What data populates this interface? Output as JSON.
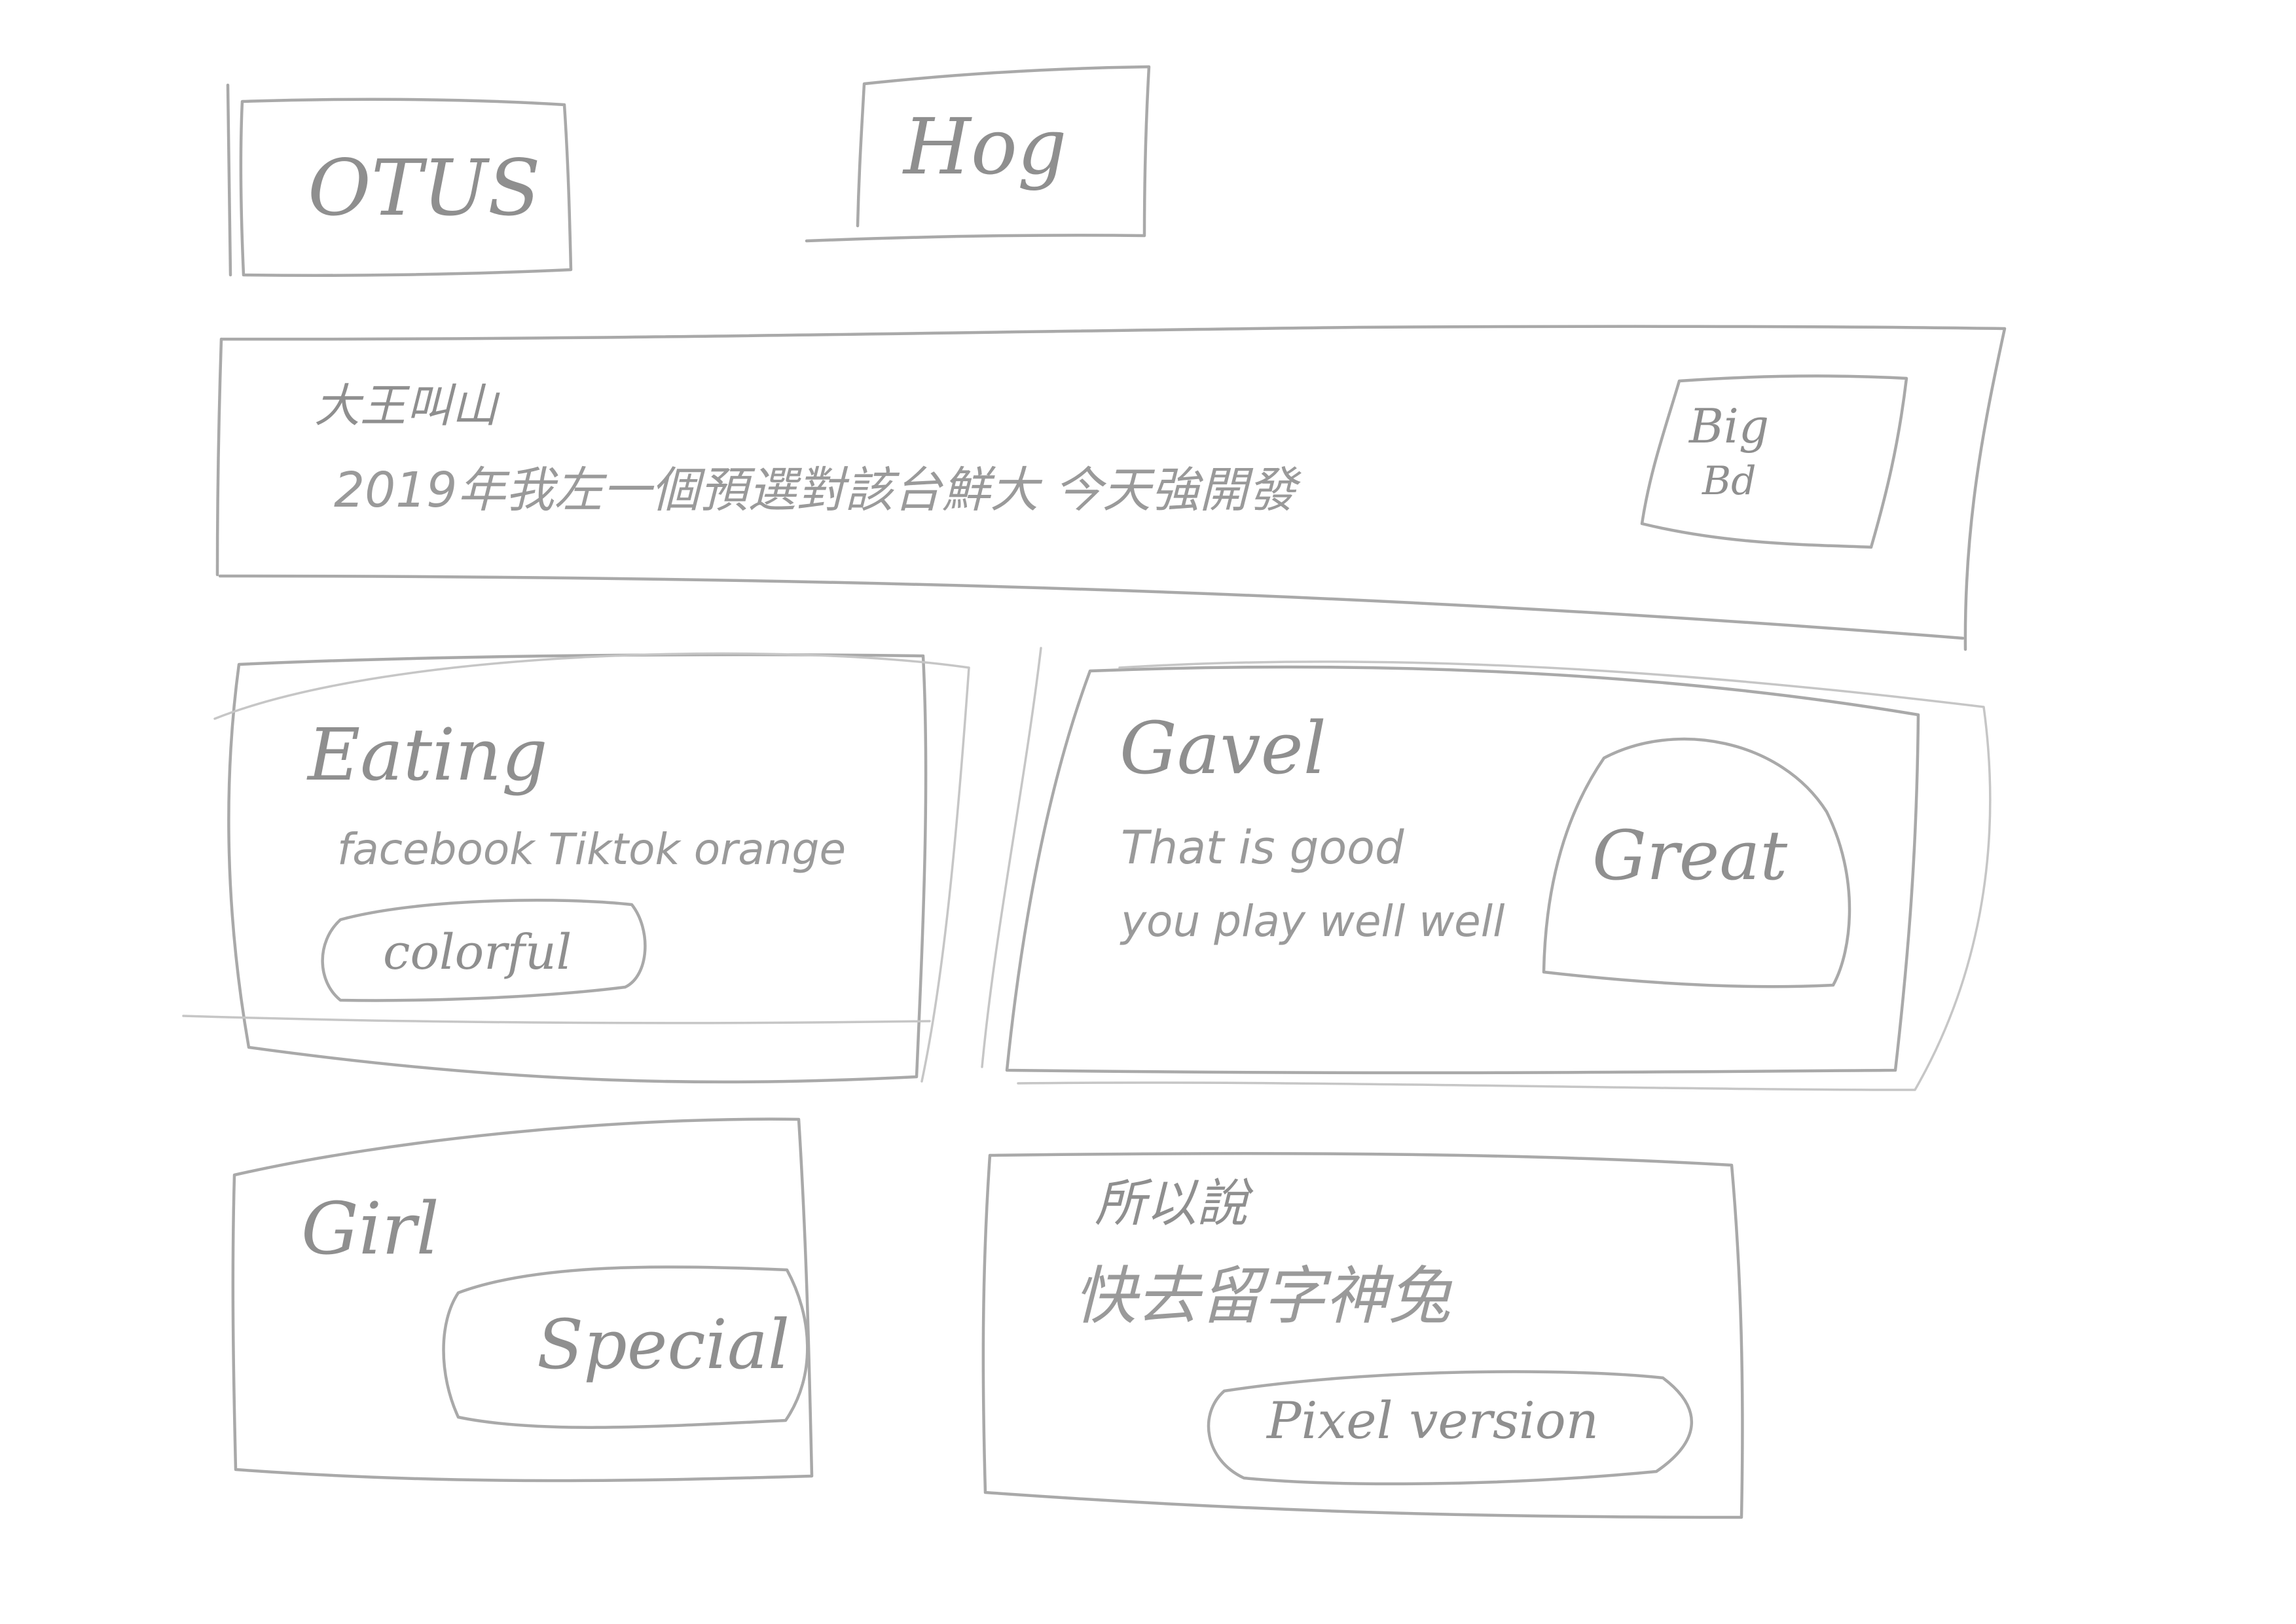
{
  "header": {
    "logo_label": "OTUS",
    "nav_label": "Hog"
  },
  "banner": {
    "title": "大王叫山",
    "text": "2019年我左一個預選對該台鮮大 今天強開發",
    "badge_line1": "Big",
    "badge_line2": "Bd"
  },
  "cards": [
    {
      "title": "Eating",
      "text": "facebook Tiktok orange",
      "tag": "colorful"
    },
    {
      "title": "Gavel",
      "text_line1": "That is good",
      "text_line2": "you play well well",
      "tag": "Great"
    },
    {
      "title": "Girl",
      "tag": "Special"
    },
    {
      "title": "所以說",
      "text": "快去留字神兔",
      "tag": "Pixel version"
    }
  ]
}
